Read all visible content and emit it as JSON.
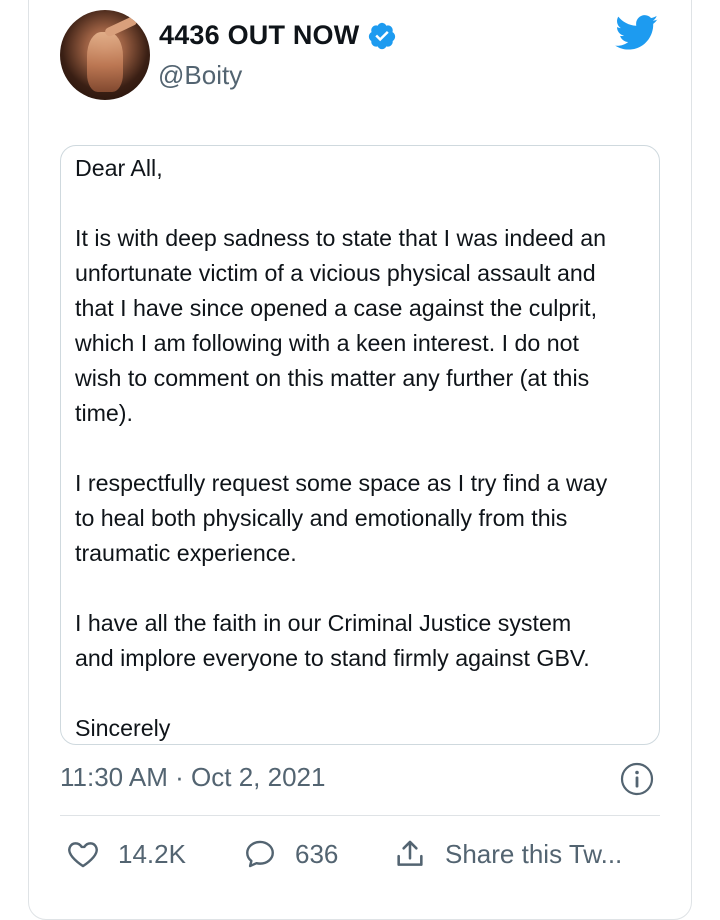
{
  "user": {
    "display_name": "4436 OUT NOW",
    "handle": "@Boity",
    "verified": true
  },
  "letter": {
    "lines": [
      "Dear All,",
      "It is with deep sadness to state that I was indeed an",
      "unfortunate victim of a vicious physical assault and",
      "that I have since opened a case against the culprit,",
      "which I am following with a keen interest. I do not",
      "wish to comment on this matter any further (at this",
      "time).",
      "I respectfully request some space as I try find a way",
      "to heal both physically and emotionally from this",
      "traumatic experience.",
      "I have all the faith in our Criminal Justice system",
      "and implore everyone to stand firmly against GBV.",
      "Sincerely"
    ]
  },
  "timestamp": "11:30 AM · Oct 2, 2021",
  "actions": {
    "likes": "14.2K",
    "replies": "636",
    "share_label": "Share this Tw..."
  },
  "colors": {
    "brand_blue": "#1d9bf0",
    "secondary_text": "#536471",
    "border": "#cfd9de"
  },
  "icons": [
    "verified-badge-icon",
    "twitter-bird-icon",
    "info-icon",
    "heart-icon",
    "reply-icon",
    "share-icon"
  ]
}
